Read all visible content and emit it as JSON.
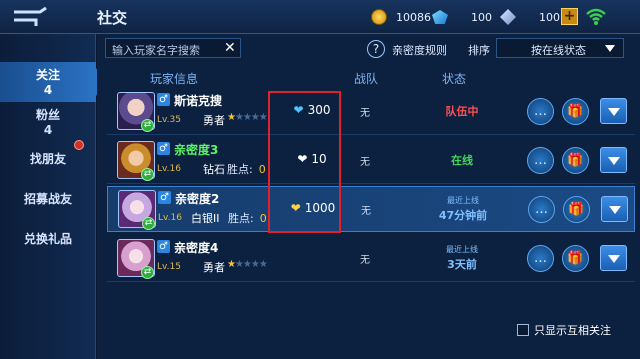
{
  "header": {
    "title": "社交",
    "currencies": [
      {
        "icon": "gold-coin-icon",
        "value": "10086"
      },
      {
        "icon": "diamond-icon",
        "value": "100"
      },
      {
        "icon": "voucher-icon",
        "value": "100"
      }
    ],
    "plus_label": "+"
  },
  "sidebar": {
    "items": [
      {
        "label": "关注",
        "count": "4"
      },
      {
        "label": "粉丝",
        "count": "4"
      },
      {
        "label": "找朋友"
      },
      {
        "label": "招募战友"
      },
      {
        "label": "兑换礼品"
      }
    ]
  },
  "search": {
    "placeholder": "输入玩家名字搜索",
    "clear": "✕"
  },
  "help": {
    "icon": "?",
    "label": "亲密度规则"
  },
  "sort": {
    "label": "排序",
    "value": "按在线状态"
  },
  "columns": {
    "player": "玩家信息",
    "team": "战队",
    "status": "状态"
  },
  "rows": [
    {
      "name": "斯诺克搜",
      "level": "Lv.35",
      "rank": "勇者",
      "stars_on": 1,
      "stars_total": 5,
      "points": "",
      "intimacy": "300",
      "heart_color": "#4ec3ff",
      "team": "无",
      "status": "队伍中",
      "status_sub": ""
    },
    {
      "name": "亲密度3",
      "level": "Lv.16",
      "rank": "钻石",
      "points_label": "胜点:",
      "points": "0",
      "intimacy": "10",
      "heart_color": "#ffffff",
      "team": "无",
      "status": "在线",
      "status_sub": ""
    },
    {
      "name": "亲密度2",
      "level": "Lv.16",
      "rank": "白银II",
      "points_label": "胜点:",
      "points": "0",
      "intimacy": "1000",
      "heart_color": "#ffd23a",
      "team": "无",
      "status": "47分钟前",
      "status_sub": "最近上线"
    },
    {
      "name": "亲密度4",
      "level": "Lv.15",
      "rank": "勇者",
      "stars_on": 1,
      "stars_total": 5,
      "points": "",
      "intimacy": "",
      "team": "无",
      "status": "3天前",
      "status_sub": "最近上线"
    }
  ],
  "footer": {
    "mutual_label": "只显示互相关注"
  }
}
